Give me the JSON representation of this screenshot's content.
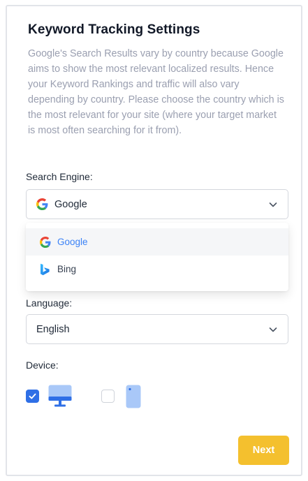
{
  "header": {
    "title": "Keyword Tracking Settings",
    "description": "Google's Search Results vary by country because Google aims to show the most relevant localized results. Hence your Keyword Rankings and traffic will also vary depending by country. Please choose the country which is the most relevant for your site (where your target market is most often searching for it from)."
  },
  "search_engine": {
    "label": "Search Engine:",
    "selected": "Google",
    "options": [
      {
        "label": "Google",
        "icon": "google-icon",
        "selected": true
      },
      {
        "label": "Bing",
        "icon": "bing-icon",
        "selected": false
      }
    ]
  },
  "language": {
    "label": "Language:",
    "selected": "English"
  },
  "device": {
    "label": "Device:",
    "options": [
      {
        "icon": "desktop-icon",
        "checked": true
      },
      {
        "icon": "mobile-icon",
        "checked": false
      }
    ]
  },
  "actions": {
    "next_label": "Next"
  },
  "colors": {
    "accent": "#2f6fe6",
    "next_button": "#f4c02e",
    "device_icon": "#a9c8f8",
    "muted_text": "#9a9fb0"
  }
}
